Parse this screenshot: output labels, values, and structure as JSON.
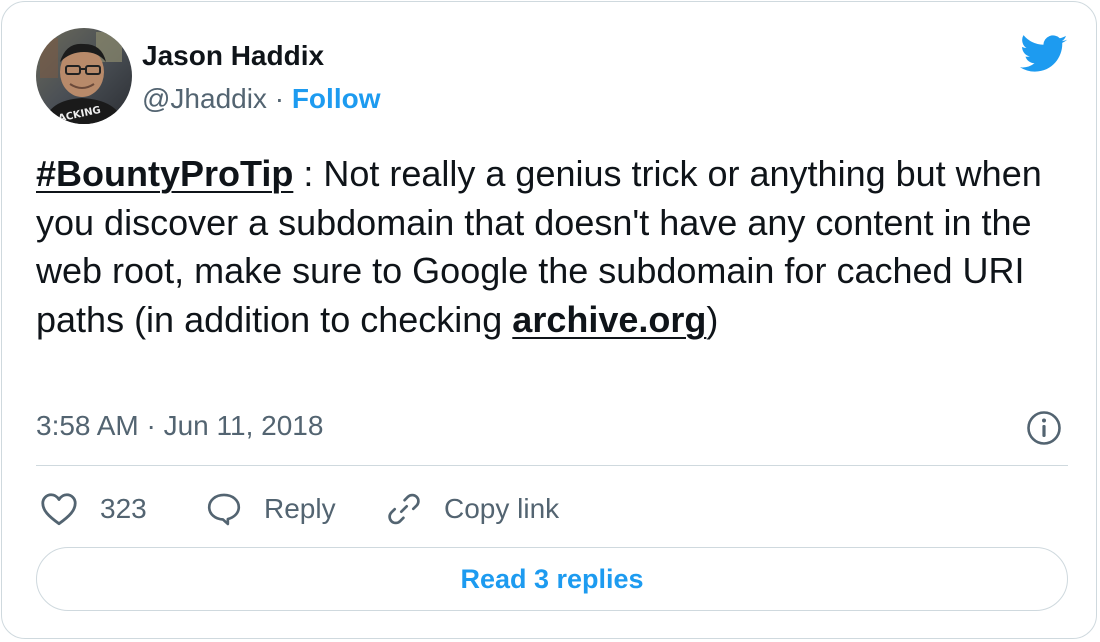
{
  "author": {
    "name": "Jason Haddix",
    "handle": "@Jhaddix",
    "separator": " · ",
    "follow_label": "Follow",
    "avatar_shirt_text": "ACKING"
  },
  "brand": {
    "icon": "twitter-bird-icon",
    "color": "#1d9bf0"
  },
  "tweet": {
    "hashtag": "#BountyProTip",
    "text_before_link": " : Not really a genius trick or anything but when you discover a subdomain that doesn't have any content in the web root, make sure to Google the subdomain for cached URI paths (in addition to checking ",
    "link_text": "archive.org",
    "text_after_link": ")"
  },
  "timestamp": "3:58 AM · Jun 11, 2018",
  "info_icon": "info-circle-icon",
  "actions": {
    "like": {
      "icon": "heart-icon",
      "count": "323"
    },
    "reply": {
      "icon": "speech-bubble-icon",
      "label": "Reply"
    },
    "copy_link": {
      "icon": "link-icon",
      "label": "Copy link"
    }
  },
  "read_replies_label": "Read 3 replies",
  "colors": {
    "text": "#0f1419",
    "secondary": "#536471",
    "accent": "#1d9bf0",
    "border": "#cfd9de"
  }
}
